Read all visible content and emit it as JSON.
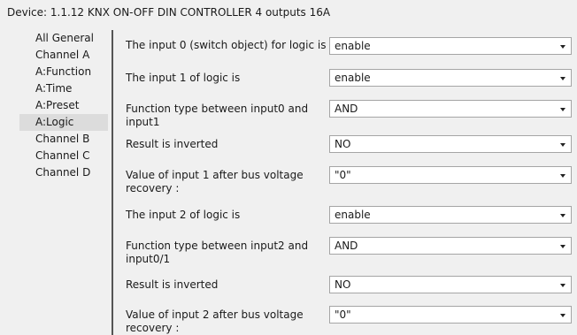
{
  "window": {
    "title": "Device: 1.1.12  KNX ON-OFF DIN CONTROLLER 4 outputs 16A"
  },
  "sidebar": {
    "items": [
      {
        "label": "All General",
        "selected": false
      },
      {
        "label": "Channel A",
        "selected": false
      },
      {
        "label": "A:Function",
        "selected": false
      },
      {
        "label": "A:Time",
        "selected": false
      },
      {
        "label": "A:Preset",
        "selected": false
      },
      {
        "label": "A:Logic",
        "selected": true
      },
      {
        "label": "Channel B",
        "selected": false
      },
      {
        "label": "Channel C",
        "selected": false
      },
      {
        "label": "Channel D",
        "selected": false
      }
    ]
  },
  "parameters": [
    {
      "label": "The input 0 (switch object) for logic is",
      "value": "enable"
    },
    {
      "label": "The input 1 of logic is",
      "value": "enable"
    },
    {
      "label": "Function type between input0 and input1",
      "value": "AND"
    },
    {
      "label": "Result is inverted",
      "value": "NO"
    },
    {
      "label": "Value of input 1 after bus voltage recovery :",
      "value": "\"0\""
    },
    {
      "label": "The input 2 of logic is",
      "value": "enable"
    },
    {
      "label": "Function type between input2 and input0/1",
      "value": "AND"
    },
    {
      "label": "Result is inverted",
      "value": "NO"
    },
    {
      "label": "Value of input 2 after bus voltage recovery :",
      "value": "\"0\""
    }
  ],
  "colors": {
    "background": "#f0f0f0",
    "selected_item": "#dcdcdc",
    "divider": "#555555",
    "dropdown_border": "#a5a5a5"
  },
  "icons": {
    "dropdown": "chevron-down-icon"
  }
}
